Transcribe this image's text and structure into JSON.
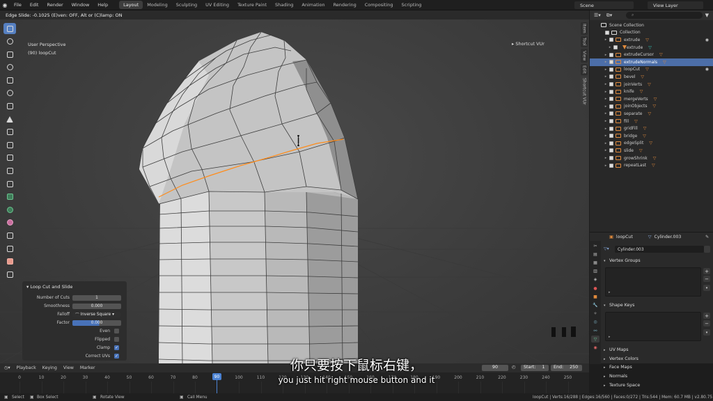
{
  "menu": {
    "items": [
      "File",
      "Edit",
      "Render",
      "Window",
      "Help"
    ],
    "workspaces": [
      "Layout",
      "Modeling",
      "Sculpting",
      "UV Editing",
      "Texture Paint",
      "Shading",
      "Animation",
      "Rendering",
      "Compositing",
      "Scripting"
    ],
    "active_workspace": "Layout",
    "scene": "Scene",
    "view_layer": "View Layer"
  },
  "viewport": {
    "header_status": "Edge Slide: -0.1025 (E)ven: OFF, Alt or (C)lamp: ON",
    "perspective": "User Perspective",
    "object_info": "(90) loopCut",
    "shortcut_label": "Shortcut VUr",
    "side_tabs": [
      "Item",
      "Tool",
      "View",
      "Edit",
      "Shortcut VUr"
    ]
  },
  "operator_panel": {
    "title": "Loop Cut and Slide",
    "number_of_cuts_label": "Number of Cuts",
    "number_of_cuts": "1",
    "smoothness_label": "Smoothness",
    "smoothness": "0.000",
    "falloff_label": "Falloff",
    "falloff": "Inverse Square",
    "factor_label": "Factor",
    "factor": "0.000",
    "even_label": "Even",
    "even": false,
    "flipped_label": "Flipped",
    "flipped": false,
    "clamp_label": "Clamp",
    "clamp": true,
    "correct_uvs_label": "Correct UVs",
    "correct_uvs": true
  },
  "outliner": {
    "search_placeholder": "",
    "rows": [
      {
        "label": "Scene Collection",
        "selected": false,
        "icon": "collection-icon"
      },
      {
        "label": "Collection",
        "selected": false,
        "icon": "collection-icon"
      },
      {
        "label": "extrude",
        "selected": false,
        "icon": "object-icon"
      },
      {
        "label": "extrude",
        "selected": false,
        "icon": "mesh-icon"
      },
      {
        "label": "extrudeCursor",
        "selected": false,
        "icon": "object-icon"
      },
      {
        "label": "extrudeNormals",
        "selected": true,
        "icon": "object-icon"
      },
      {
        "label": "loopCut",
        "selected": false,
        "icon": "object-icon"
      },
      {
        "label": "bevel",
        "selected": false,
        "icon": "object-icon"
      },
      {
        "label": "joinVerts",
        "selected": false,
        "icon": "object-icon"
      },
      {
        "label": "knife",
        "selected": false,
        "icon": "object-icon"
      },
      {
        "label": "mergeVerts",
        "selected": false,
        "icon": "object-icon"
      },
      {
        "label": "joinObjects",
        "selected": false,
        "icon": "object-icon"
      },
      {
        "label": "separate",
        "selected": false,
        "icon": "object-icon"
      },
      {
        "label": "fill",
        "selected": false,
        "icon": "object-icon"
      },
      {
        "label": "gridFill",
        "selected": false,
        "icon": "object-icon"
      },
      {
        "label": "bridge",
        "selected": false,
        "icon": "object-icon"
      },
      {
        "label": "edgeSplit",
        "selected": false,
        "icon": "object-icon"
      },
      {
        "label": "slide",
        "selected": false,
        "icon": "object-icon"
      },
      {
        "label": "growShrink",
        "selected": false,
        "icon": "object-icon"
      },
      {
        "label": "repeatLast",
        "selected": false,
        "icon": "object-icon"
      }
    ]
  },
  "properties": {
    "object_name": "loopCut",
    "mesh_name": "Cylinder.003",
    "mesh_field": "Cylinder.003",
    "sections": [
      "Vertex Groups",
      "Shape Keys",
      "UV Maps",
      "Vertex Colors",
      "Face Maps",
      "Normals",
      "Texture Space"
    ]
  },
  "timeline": {
    "menus": [
      "Playback",
      "Keying",
      "View",
      "Marker"
    ],
    "current_frame": "90",
    "start_label": "Start:",
    "start": "1",
    "end_label": "End:",
    "end": "250",
    "ticks": [
      "0",
      "10",
      "20",
      "30",
      "40",
      "50",
      "60",
      "70",
      "80",
      "90",
      "100",
      "110",
      "120",
      "130",
      "140",
      "150",
      "160",
      "170",
      "180",
      "190",
      "200",
      "210",
      "220",
      "230",
      "240",
      "250"
    ]
  },
  "statusbar": {
    "select": "Select",
    "box_select": "Box Select",
    "rotate_view": "Rotate View",
    "call_menu": "Call Menu",
    "stats": "loopCut | Verts:16/288 | Edges:16/560 | Faces:0/272 | Tris:544 | Mem: 60.7 MB | v2.80.75"
  },
  "subtitles": {
    "cn": "你只要按下鼠标右键，",
    "en": "you just hit right mouse button and it"
  },
  "colors": {
    "accent": "#4b82d2",
    "selection_edge": "#ff8c1a",
    "outliner_selected": "#4c6ea8",
    "object_icon": "#e08a3c"
  }
}
